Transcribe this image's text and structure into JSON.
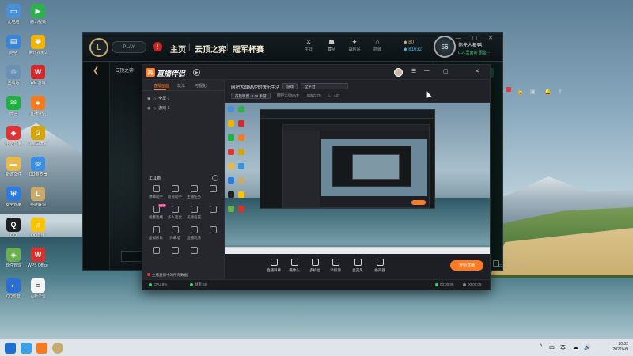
{
  "desktop": {
    "icons": [
      {
        "label": "此电脑",
        "name": "this-pc-icon",
        "color": "#4a90d9",
        "glyph": "▭"
      },
      {
        "label": "腾讯视频",
        "name": "tencent-video-icon",
        "color": "#2bb24c",
        "glyph": "▶"
      },
      {
        "label": "网络",
        "name": "network-icon",
        "color": "#3a84d6",
        "glyph": "▤"
      },
      {
        "label": "腾讯视频2",
        "name": "tencent-video-alt-icon",
        "color": "#f0b400",
        "glyph": "◉"
      },
      {
        "label": "回收站",
        "name": "recycle-bin-icon",
        "color": "#6b8fb5",
        "glyph": "♲"
      },
      {
        "label": "WE 游戏",
        "name": "we-game-icon",
        "color": "#d22a2a",
        "glyph": "W"
      },
      {
        "label": "微信",
        "name": "wechat-icon",
        "color": "#20b040",
        "glyph": "✉"
      },
      {
        "label": "直播伴侣",
        "name": "live-companion-icon",
        "color": "#f47b20",
        "glyph": "●"
      },
      {
        "label": "电脑管家",
        "name": "pc-manager-icon",
        "color": "#e23232",
        "glyph": "◆"
      },
      {
        "label": "WeGame",
        "name": "wegame-icon",
        "color": "#d9a400",
        "glyph": "G"
      },
      {
        "label": "新建文件",
        "name": "folder-icon",
        "color": "#e8b84a",
        "glyph": "▬"
      },
      {
        "label": "QQ浏览器",
        "name": "qq-browser-icon",
        "color": "#3b8fe0",
        "glyph": "◎"
      },
      {
        "label": "安全管家",
        "name": "security-icon",
        "color": "#2c7be5",
        "glyph": "⛨"
      },
      {
        "label": "英雄联盟",
        "name": "league-icon",
        "color": "#c8aa6e",
        "glyph": "L"
      },
      {
        "label": "QQ",
        "name": "qq-icon",
        "color": "#1f1f1f",
        "glyph": "Q"
      },
      {
        "label": "QQ音乐",
        "name": "qq-music-icon",
        "color": "#ffc300",
        "glyph": "♫"
      },
      {
        "label": "软件管理",
        "name": "software-manager-icon",
        "color": "#6ab04c",
        "glyph": "◈"
      },
      {
        "label": "WPS Office",
        "name": "wps-office-icon",
        "color": "#d9302c",
        "glyph": "W"
      },
      {
        "label": "QQ影音",
        "name": "qq-player-icon",
        "color": "#2b6fd6",
        "glyph": "◐"
      },
      {
        "label": "更新公告",
        "name": "notice-doc-icon",
        "color": "#f5f5f5",
        "glyph": "≡"
      }
    ]
  },
  "lol": {
    "logo": "L",
    "play": "PLAY",
    "alert": "!",
    "nav": [
      "主页",
      "云顶之弈",
      "冠军杯赛"
    ],
    "tools": [
      {
        "icon": "⚔",
        "label": "生涯"
      },
      {
        "icon": "☗",
        "label": "藏品"
      },
      {
        "icon": "✦",
        "label": "战利品"
      },
      {
        "icon": "⌂",
        "label": "商城"
      }
    ],
    "currency": {
      "rp": "80",
      "be": "81632"
    },
    "user": {
      "name": "你先人板鸭",
      "status": "LOL里面的 图鉴 ···",
      "level": "56"
    },
    "winbtns": "— ▢ ✕",
    "back": "❮",
    "sub": "云顶之弈"
  },
  "zb": {
    "brand": "直播伴侣",
    "logo": "抖",
    "play": "▶",
    "title_btns": [
      "☰",
      "—",
      "▢",
      "✕"
    ],
    "tabs": [
      "直播画面",
      "玩法",
      "可视化"
    ],
    "scenes": [
      {
        "eye": "👁",
        "lock": "🔓",
        "label": "全屏 1"
      },
      {
        "eye": "👁",
        "lock": "🔓",
        "label": "游戏 1"
      }
    ],
    "tools_title": "工具箱",
    "tools": [
      {
        "label": "弹幕助手",
        "name": "danmu-helper"
      },
      {
        "label": "房管助手",
        "name": "room-admin"
      },
      {
        "label": "主播任务",
        "name": "host-task"
      },
      {
        "label": "",
        "name": "add-tool"
      },
      {
        "label": "视频连线",
        "name": "video-link",
        "badge": "NEW"
      },
      {
        "label": "多人连麦",
        "name": "multi-mic"
      },
      {
        "label": "美颜设置",
        "name": "beauty-settings"
      },
      {
        "label": "",
        "name": "more-tools"
      },
      {
        "label": "虚拟形象",
        "name": "avatar-tool"
      },
      {
        "label": "弹幕墙",
        "name": "danmu-wall"
      },
      {
        "label": "直播玩法",
        "name": "live-play"
      },
      {
        "label": "",
        "name": "extra-tool"
      },
      {
        "label": "",
        "name": "extra-tool-2"
      },
      {
        "label": "",
        "name": "extra-tool-3"
      },
      {
        "label": "",
        "name": "extra-tool-4"
      }
    ],
    "live_note": "主播直播中的所有数据",
    "room": {
      "title": "网吧大战MVP的快乐生活",
      "chip1": "游戏",
      "chip2": "全平台",
      "meta1": "英雄联盟 · LOL手游",
      "meta2": "网吧大战MVP",
      "meta3": "9257270",
      "meta4": "447"
    },
    "icons": [
      "⌂",
      "🔓",
      "▣",
      "🔔",
      "⇪"
    ],
    "controls": [
      {
        "label": "直播屏幕",
        "name": "screen-capture"
      },
      {
        "label": "摄像头",
        "name": "camera"
      },
      {
        "label": "多机位",
        "name": "multi-camera"
      },
      {
        "label": "添加源",
        "name": "add-source"
      },
      {
        "label": "麦克风",
        "name": "microphone"
      },
      {
        "label": "扬声器",
        "name": "speaker"
      }
    ],
    "mini": [
      "▭",
      "◎",
      "⚙"
    ],
    "start": "开始直播",
    "status": [
      {
        "label": "CPU:8%",
        "color": "#3cd071"
      },
      {
        "label": "帧率:60",
        "color": "#3cd071"
      },
      {
        "label": "00:00:05",
        "color": "#3cd071"
      },
      {
        "label": "00:00:05",
        "color": "#888888"
      }
    ]
  },
  "taskbar": {
    "tray": [
      "^",
      "中",
      "英",
      "☁",
      "🔊"
    ],
    "time": "20:02",
    "date": "2022/4/9"
  }
}
